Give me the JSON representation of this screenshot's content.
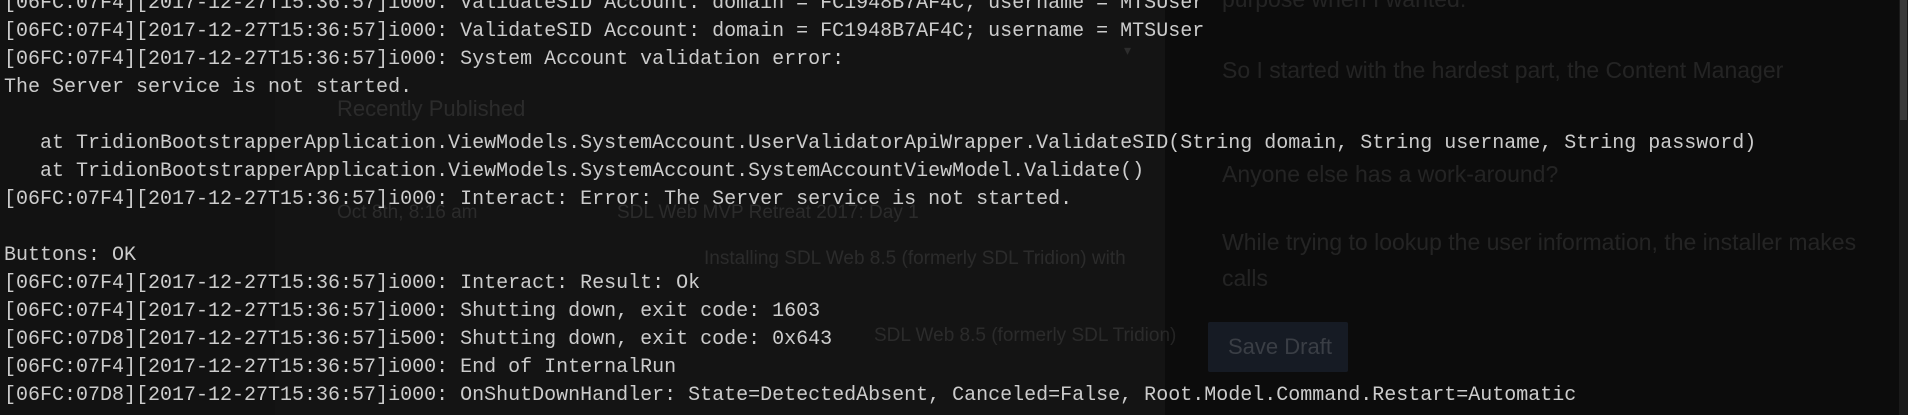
{
  "background_page": {
    "text_top": "purpose when I wanted.",
    "recently_published": "Recently Published",
    "intro": "So I started with the hardest part, the Content Manager",
    "question": "Anyone else has a work-around?",
    "date": "Oct 8th, 8:16 am",
    "post1": "SDL Web MVP Retreat 2017: Day 1",
    "post2": "Installing SDL Web 8.5 (formerly SDL Tridion) with",
    "post3": "SDL Web 8.5 (formerly SDL Tridion)",
    "paragraph1": "While trying to lookup the user information, the installer makes",
    "paragraph2": "calls",
    "save_draft": "Save Draft"
  },
  "console": {
    "lines": [
      "[06FC:07F4][2017-12-27T15:36:57]i000: ValidateSID Account: domain = FC1948B7AF4C; username = MTSUser",
      "[06FC:07F4][2017-12-27T15:36:57]i000: ValidateSID Account: domain = FC1948B7AF4C; username = MTSUser",
      "[06FC:07F4][2017-12-27T15:36:57]i000: System Account validation error:",
      "The Server service is not started.",
      "",
      "   at TridionBootstrapperApplication.ViewModels.SystemAccount.UserValidatorApiWrapper.ValidateSID(String domain, String username, String password)",
      "   at TridionBootstrapperApplication.ViewModels.SystemAccount.SystemAccountViewModel.Validate()",
      "[06FC:07F4][2017-12-27T15:36:57]i000: Interact: Error: The Server service is not started.",
      "",
      "Buttons: OK",
      "[06FC:07F4][2017-12-27T15:36:57]i000: Interact: Result: Ok",
      "[06FC:07F4][2017-12-27T15:36:57]i000: Shutting down, exit code: 1603",
      "[06FC:07D8][2017-12-27T15:36:57]i500: Shutting down, exit code: 0x643",
      "[06FC:07F4][2017-12-27T15:36:57]i000: End of InternalRun",
      "[06FC:07D8][2017-12-27T15:36:57]i000: OnShutDownHandler: State=DetectedAbsent, Canceled=False, Root.Model.Command.Restart=Automatic"
    ]
  }
}
